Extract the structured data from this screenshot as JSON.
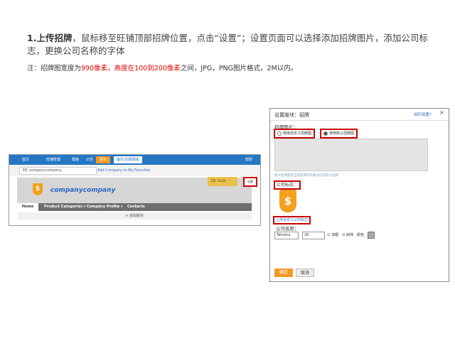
{
  "instruction": {
    "heading": "1.上传招牌",
    "text": "，鼠标移至旺铺顶部招牌位置，点击“设置”；设置页面可以选择添加招牌图片，添加公司标志，更换公司名称的字体",
    "note_prefix": "注：招牌图宽度为",
    "note_red1": "990像素，高度在100到200像素",
    "note_suffix": "之间，JPG，PNG图片格式，2M以内。"
  },
  "storefront": {
    "topbar_items": [
      "首页",
      "旺铺管理",
      "模板",
      "公告"
    ],
    "topbar_btn_orange": "发布",
    "topbar_btn_white": "备份/加载模板",
    "topbar_right": "帮助",
    "sub_select": "3年 companycompany",
    "add_favorites": "Add Company to My Favorites",
    "company_name": "companycompany",
    "gold_badge": "3年  Gold",
    "setting_btn": "设置",
    "nav": [
      "Home",
      "Product Categories ▾",
      "Company Profile ▾",
      "Contacts"
    ],
    "add_section": "+ 添加版块"
  },
  "dialog": {
    "title": "设置版块：招牌",
    "help": "如何设置?",
    "close": "×",
    "banner_label": "招牌图片：",
    "radio1": "使用自定义招牌图",
    "radio2": "使用默认招牌图",
    "hint": "默认招牌图是当前使用的风格对应的默认招牌",
    "logo_label": "公司标志：",
    "upload": "上传自定义公司标志",
    "name_label": "公司名称：",
    "font": "Tahoma",
    "size": "26",
    "bold": "加粗",
    "italic": "斜体",
    "color": "颜色",
    "ok": "确定",
    "cancel": "取消"
  }
}
